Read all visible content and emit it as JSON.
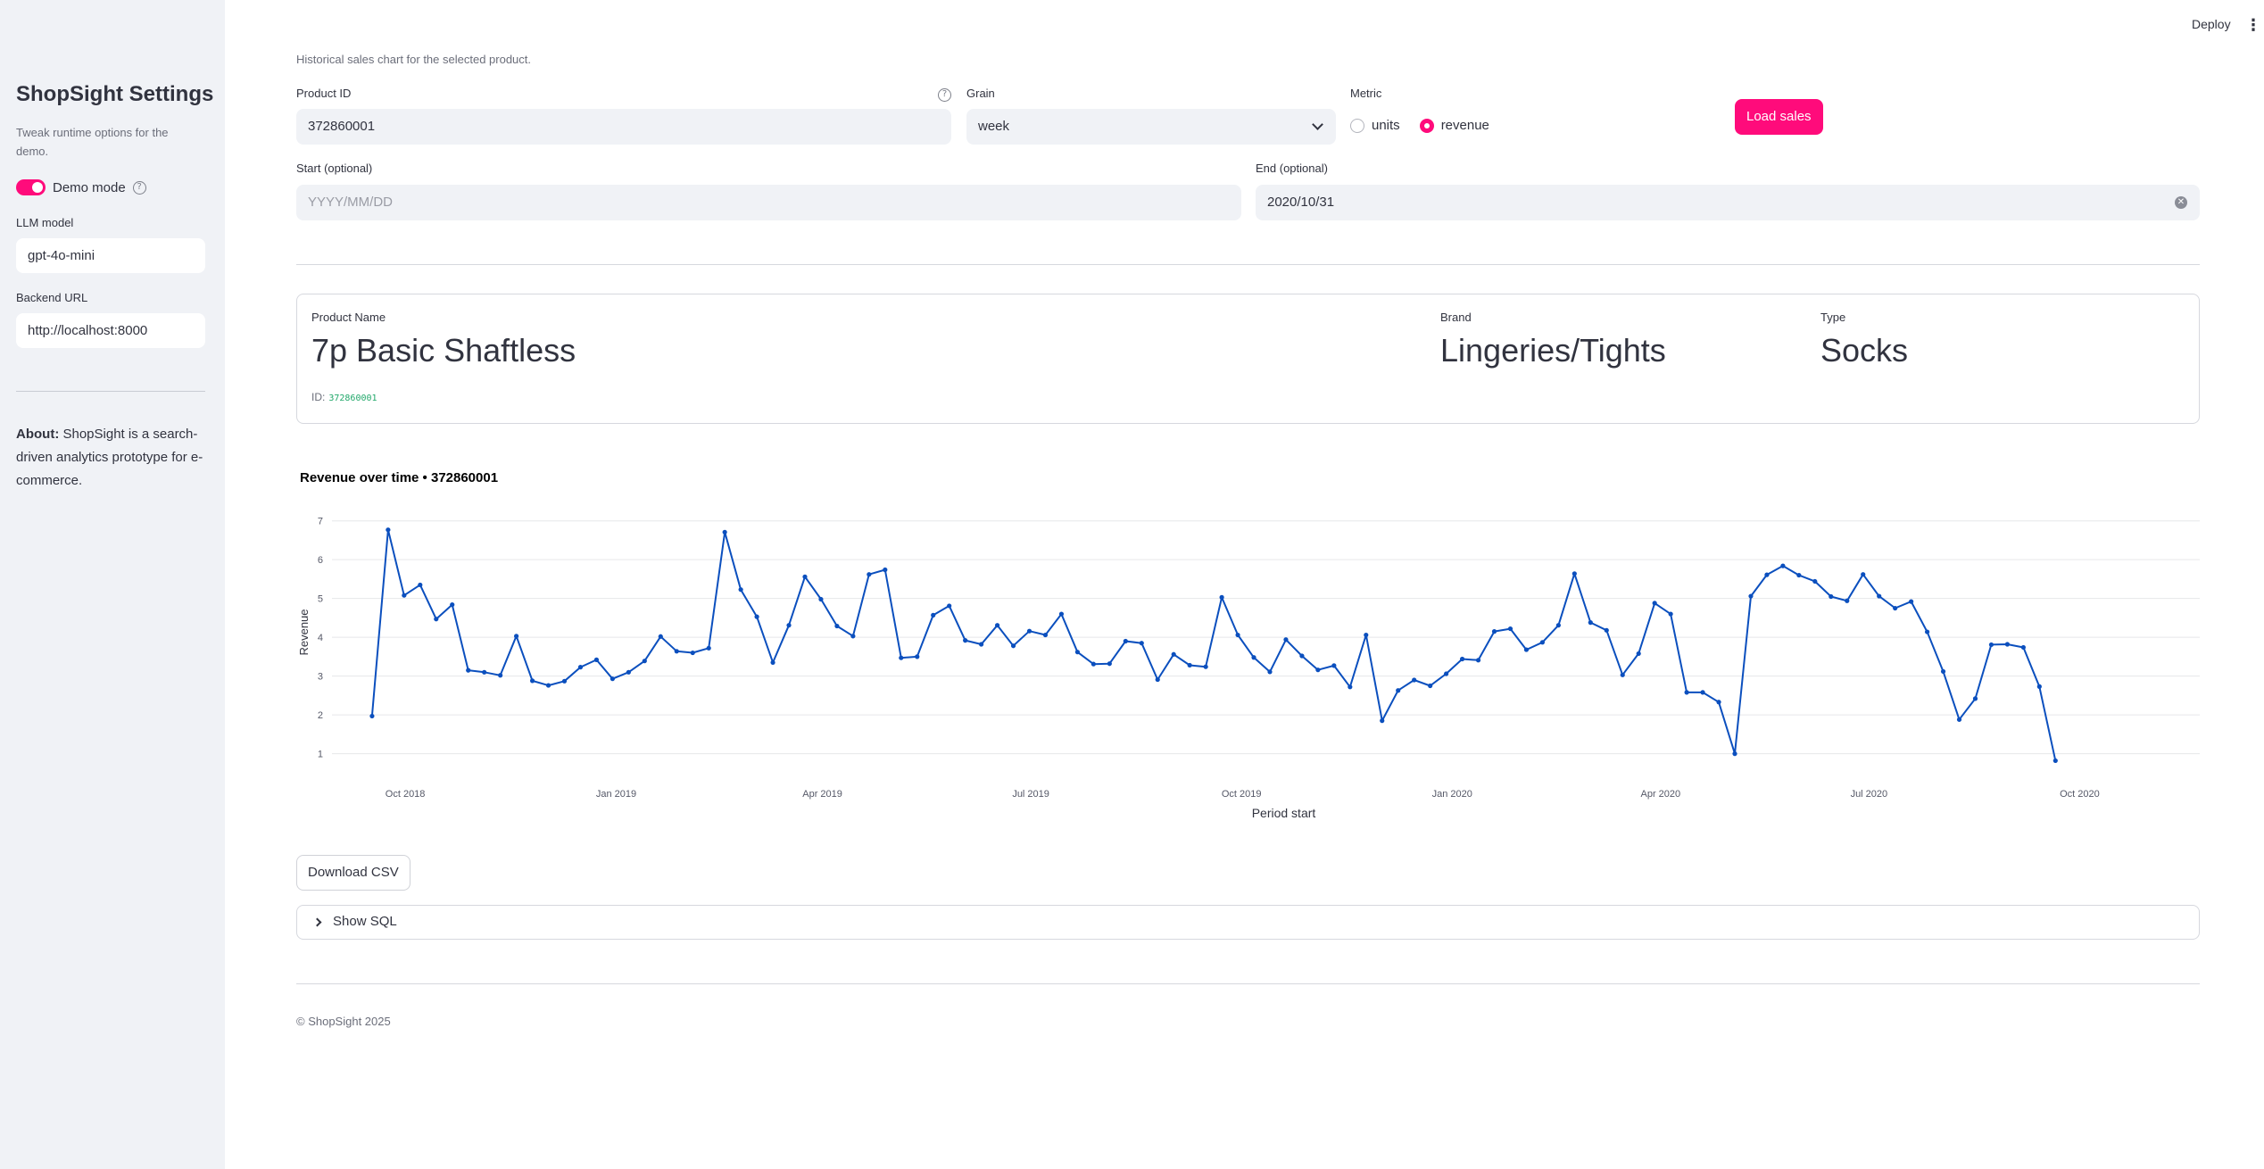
{
  "sidebar": {
    "title": "ShopSight Settings",
    "subtitle": "Tweak runtime options for the demo.",
    "demo_mode": {
      "label": "Demo mode",
      "on": true
    },
    "llm_model": {
      "label": "LLM model",
      "value": "gpt-4o-mini"
    },
    "backend_url": {
      "label": "Backend URL",
      "value": "http://localhost:8000"
    },
    "about_bold": "About:",
    "about_text": " ShopSight is a search-driven analytics prototype for e-commerce."
  },
  "topbar": {
    "deploy": "Deploy",
    "menu_icon": "more-vertical-icon"
  },
  "main": {
    "caption": "Historical sales chart for the selected product.",
    "product_id": {
      "label": "Product ID",
      "value": "372860001"
    },
    "grain": {
      "label": "Grain",
      "value": "week"
    },
    "metric": {
      "label": "Metric",
      "options": [
        "units",
        "revenue"
      ],
      "selected": "revenue"
    },
    "load_button": "Load sales",
    "start": {
      "label": "Start (optional)",
      "placeholder": "YYYY/MM/DD",
      "value": ""
    },
    "end": {
      "label": "End (optional)",
      "value": "2020/10/31"
    }
  },
  "product": {
    "name_label": "Product Name",
    "name": "7p Basic Shaftless",
    "brand_label": "Brand",
    "brand": "Lingeries/Tights",
    "type_label": "Type",
    "type": "Socks",
    "id_label": "ID:",
    "id": "372860001"
  },
  "chart_data": {
    "type": "line",
    "title": "Revenue over time • 372860001",
    "xlabel": "Period start",
    "ylabel": "Revenue",
    "ylim": [
      0.6,
      7.2
    ],
    "yticks": [
      1,
      2,
      3,
      4,
      5,
      6,
      7
    ],
    "xtick_labels": [
      "Oct 2018",
      "Jan 2019",
      "Apr 2019",
      "Jul 2019",
      "Oct 2019",
      "Jan 2020",
      "Apr 2020",
      "Jul 2020",
      "Oct 2020"
    ],
    "xlim_week_index": [
      -2.5,
      114
    ],
    "grid": true,
    "line_color": "#0b4fbe",
    "series": [
      {
        "values": [
          1.97,
          6.77,
          5.08,
          5.35,
          4.47,
          4.84,
          3.15,
          3.1,
          3.02,
          4.03,
          2.88,
          2.76,
          2.87,
          3.23,
          3.42,
          2.93,
          3.1,
          3.39,
          4.02,
          3.64,
          3.6,
          3.72,
          6.71,
          5.23,
          4.53,
          3.35,
          4.31,
          5.56,
          4.98,
          4.29,
          4.03,
          5.62,
          5.74,
          3.47,
          3.5,
          4.57,
          4.81,
          3.92,
          3.82,
          4.31,
          3.78,
          4.16,
          4.06,
          4.6,
          3.62,
          3.31,
          3.32,
          3.9,
          3.85,
          2.91,
          3.56,
          3.28,
          3.24,
          5.03,
          4.06,
          3.48,
          3.11,
          3.94,
          3.52,
          3.16,
          3.27,
          2.72,
          4.06,
          1.85,
          2.63,
          2.9,
          2.75,
          3.06,
          3.44,
          3.41,
          4.15,
          4.22,
          3.68,
          3.87,
          4.31,
          5.64,
          4.38,
          4.18,
          3.03,
          3.58,
          4.88,
          4.6,
          2.58,
          2.58,
          2.33,
          1.0,
          5.06,
          5.61,
          5.84,
          5.6,
          5.44,
          5.05,
          4.94,
          5.62,
          5.06,
          4.75,
          4.92,
          4.14,
          3.12,
          1.88,
          2.42,
          3.81,
          3.82,
          3.74,
          2.73,
          0.82
        ]
      }
    ]
  },
  "actions": {
    "download": "Download CSV",
    "show_sql": "Show SQL"
  },
  "footer": "© ShopSight 2025"
}
